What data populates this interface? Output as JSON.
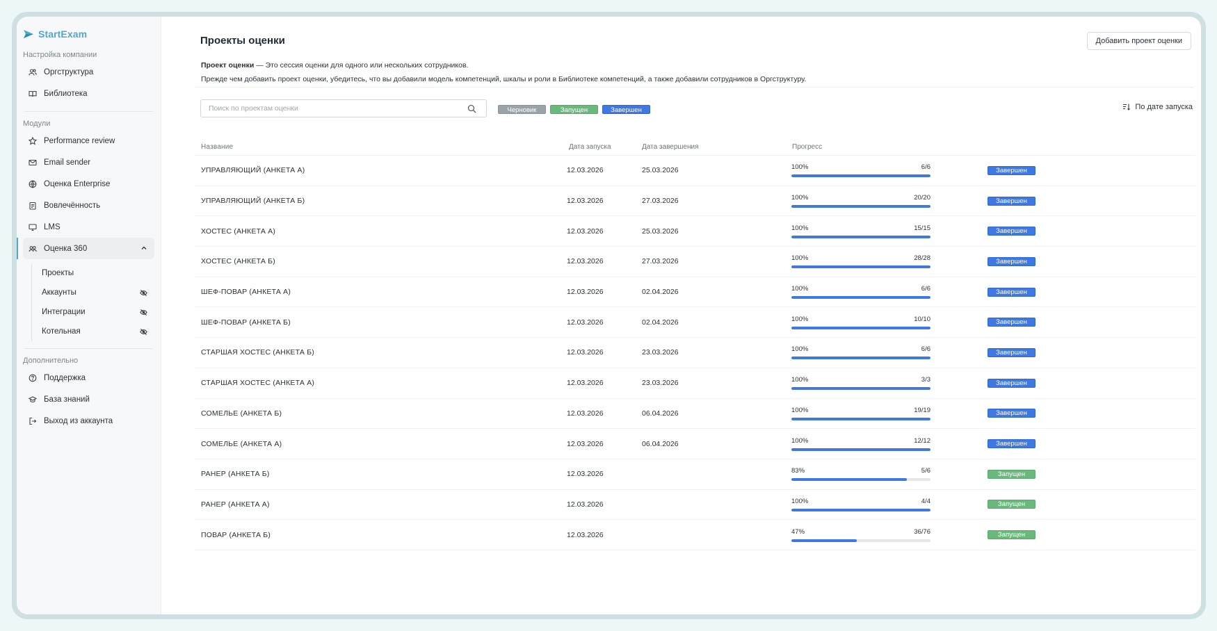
{
  "brand": {
    "name": "StartExam"
  },
  "sidebar": {
    "section_company": "Настройка компании",
    "company_items": [
      {
        "label": "Оргструктура",
        "icon": "users-icon"
      },
      {
        "label": "Библиотека",
        "icon": "book-icon"
      }
    ],
    "section_modules": "Модули",
    "module_items": [
      {
        "label": "Performance review",
        "icon": "star-icon"
      },
      {
        "label": "Email sender",
        "icon": "mail-icon"
      },
      {
        "label": "Оценка Enterprise",
        "icon": "globe-icon"
      },
      {
        "label": "Вовлечённость",
        "icon": "clipboard-icon"
      },
      {
        "label": "LMS",
        "icon": "monitor-icon"
      },
      {
        "label": "Оценка 360",
        "icon": "users-circle-icon"
      }
    ],
    "sub_items": [
      {
        "label": "Проекты"
      },
      {
        "label": "Аккаунты"
      },
      {
        "label": "Интеграции"
      },
      {
        "label": "Котельная"
      }
    ],
    "section_extra": "Дополнительно",
    "extra_items": [
      {
        "label": "Поддержка",
        "icon": "help-icon"
      },
      {
        "label": "База знаний",
        "icon": "graduation-cap-icon"
      },
      {
        "label": "Выход из аккаунта",
        "icon": "logout-icon"
      }
    ]
  },
  "header": {
    "title": "Проекты оценки",
    "add_button": "Добавить проект оценки",
    "desc_bold": "Проект оценки",
    "desc_line1": " — Это сессия оценки для одного или нескольких сотрудников.",
    "desc_line2": "Прежде чем добавить проект оценки, убедитесь, что вы добавили модель компетенций, шкалы и роли в Библиотеке компетенций, а также добавили сотрудников в Оргструктуру."
  },
  "toolbar": {
    "search_placeholder": "Поиск по проектам оценки",
    "filter_draft": "Черновик",
    "filter_running": "Запущен",
    "filter_done": "Завершен",
    "sort_label": "По дате запуска"
  },
  "colors": {
    "accent": "#4fa8c7",
    "done": "#3f78e0",
    "running": "#6ab87c",
    "draft": "#9aa3aa"
  },
  "table": {
    "columns": {
      "name": "Название",
      "start": "Дата запуска",
      "end": "Дата завершения",
      "progress": "Прогресс"
    },
    "rows": [
      {
        "name": "УПРАВЛЯЮЩИЙ (АНКЕТА А)",
        "start": "12.03.2026",
        "end": "25.03.2026",
        "pct_label": "100%",
        "pct": 100,
        "count": "6/6",
        "status": "Завершен",
        "status_kind": "done"
      },
      {
        "name": "УПРАВЛЯЮЩИЙ (АНКЕТА Б)",
        "start": "12.03.2026",
        "end": "27.03.2026",
        "pct_label": "100%",
        "pct": 100,
        "count": "20/20",
        "status": "Завершен",
        "status_kind": "done"
      },
      {
        "name": "ХОСТЕС (АНКЕТА А)",
        "start": "12.03.2026",
        "end": "25.03.2026",
        "pct_label": "100%",
        "pct": 100,
        "count": "15/15",
        "status": "Завершен",
        "status_kind": "done"
      },
      {
        "name": "ХОСТЕС (АНКЕТА Б)",
        "start": "12.03.2026",
        "end": "27.03.2026",
        "pct_label": "100%",
        "pct": 100,
        "count": "28/28",
        "status": "Завершен",
        "status_kind": "done"
      },
      {
        "name": "ШЕФ-ПОВАР (АНКЕТА А)",
        "start": "12.03.2026",
        "end": "02.04.2026",
        "pct_label": "100%",
        "pct": 100,
        "count": "6/6",
        "status": "Завершен",
        "status_kind": "done"
      },
      {
        "name": "ШЕФ-ПОВАР (АНКЕТА Б)",
        "start": "12.03.2026",
        "end": "02.04.2026",
        "pct_label": "100%",
        "pct": 100,
        "count": "10/10",
        "status": "Завершен",
        "status_kind": "done"
      },
      {
        "name": "СТАРШАЯ ХОСТЕС (АНКЕТА Б)",
        "start": "12.03.2026",
        "end": "23.03.2026",
        "pct_label": "100%",
        "pct": 100,
        "count": "6/6",
        "status": "Завершен",
        "status_kind": "done"
      },
      {
        "name": "СТАРШАЯ ХОСТЕС (АНКЕТА А)",
        "start": "12.03.2026",
        "end": "23.03.2026",
        "pct_label": "100%",
        "pct": 100,
        "count": "3/3",
        "status": "Завершен",
        "status_kind": "done"
      },
      {
        "name": "СОМЕЛЬЕ (АНКЕТА Б)",
        "start": "12.03.2026",
        "end": "06.04.2026",
        "pct_label": "100%",
        "pct": 100,
        "count": "19/19",
        "status": "Завершен",
        "status_kind": "done"
      },
      {
        "name": "СОМЕЛЬЕ (АНКЕТА А)",
        "start": "12.03.2026",
        "end": "06.04.2026",
        "pct_label": "100%",
        "pct": 100,
        "count": "12/12",
        "status": "Завершен",
        "status_kind": "done"
      },
      {
        "name": "РАНЕР (АНКЕТА Б)",
        "start": "12.03.2026",
        "end": "",
        "pct_label": "83%",
        "pct": 83,
        "count": "5/6",
        "status": "Запущен",
        "status_kind": "running"
      },
      {
        "name": "РАНЕР (АНКЕТА А)",
        "start": "12.03.2026",
        "end": "",
        "pct_label": "100%",
        "pct": 100,
        "count": "4/4",
        "status": "Запущен",
        "status_kind": "running"
      },
      {
        "name": "ПОВАР (АНКЕТА Б)",
        "start": "12.03.2026",
        "end": "",
        "pct_label": "47%",
        "pct": 47,
        "count": "36/76",
        "status": "Запущен",
        "status_kind": "running"
      }
    ]
  }
}
